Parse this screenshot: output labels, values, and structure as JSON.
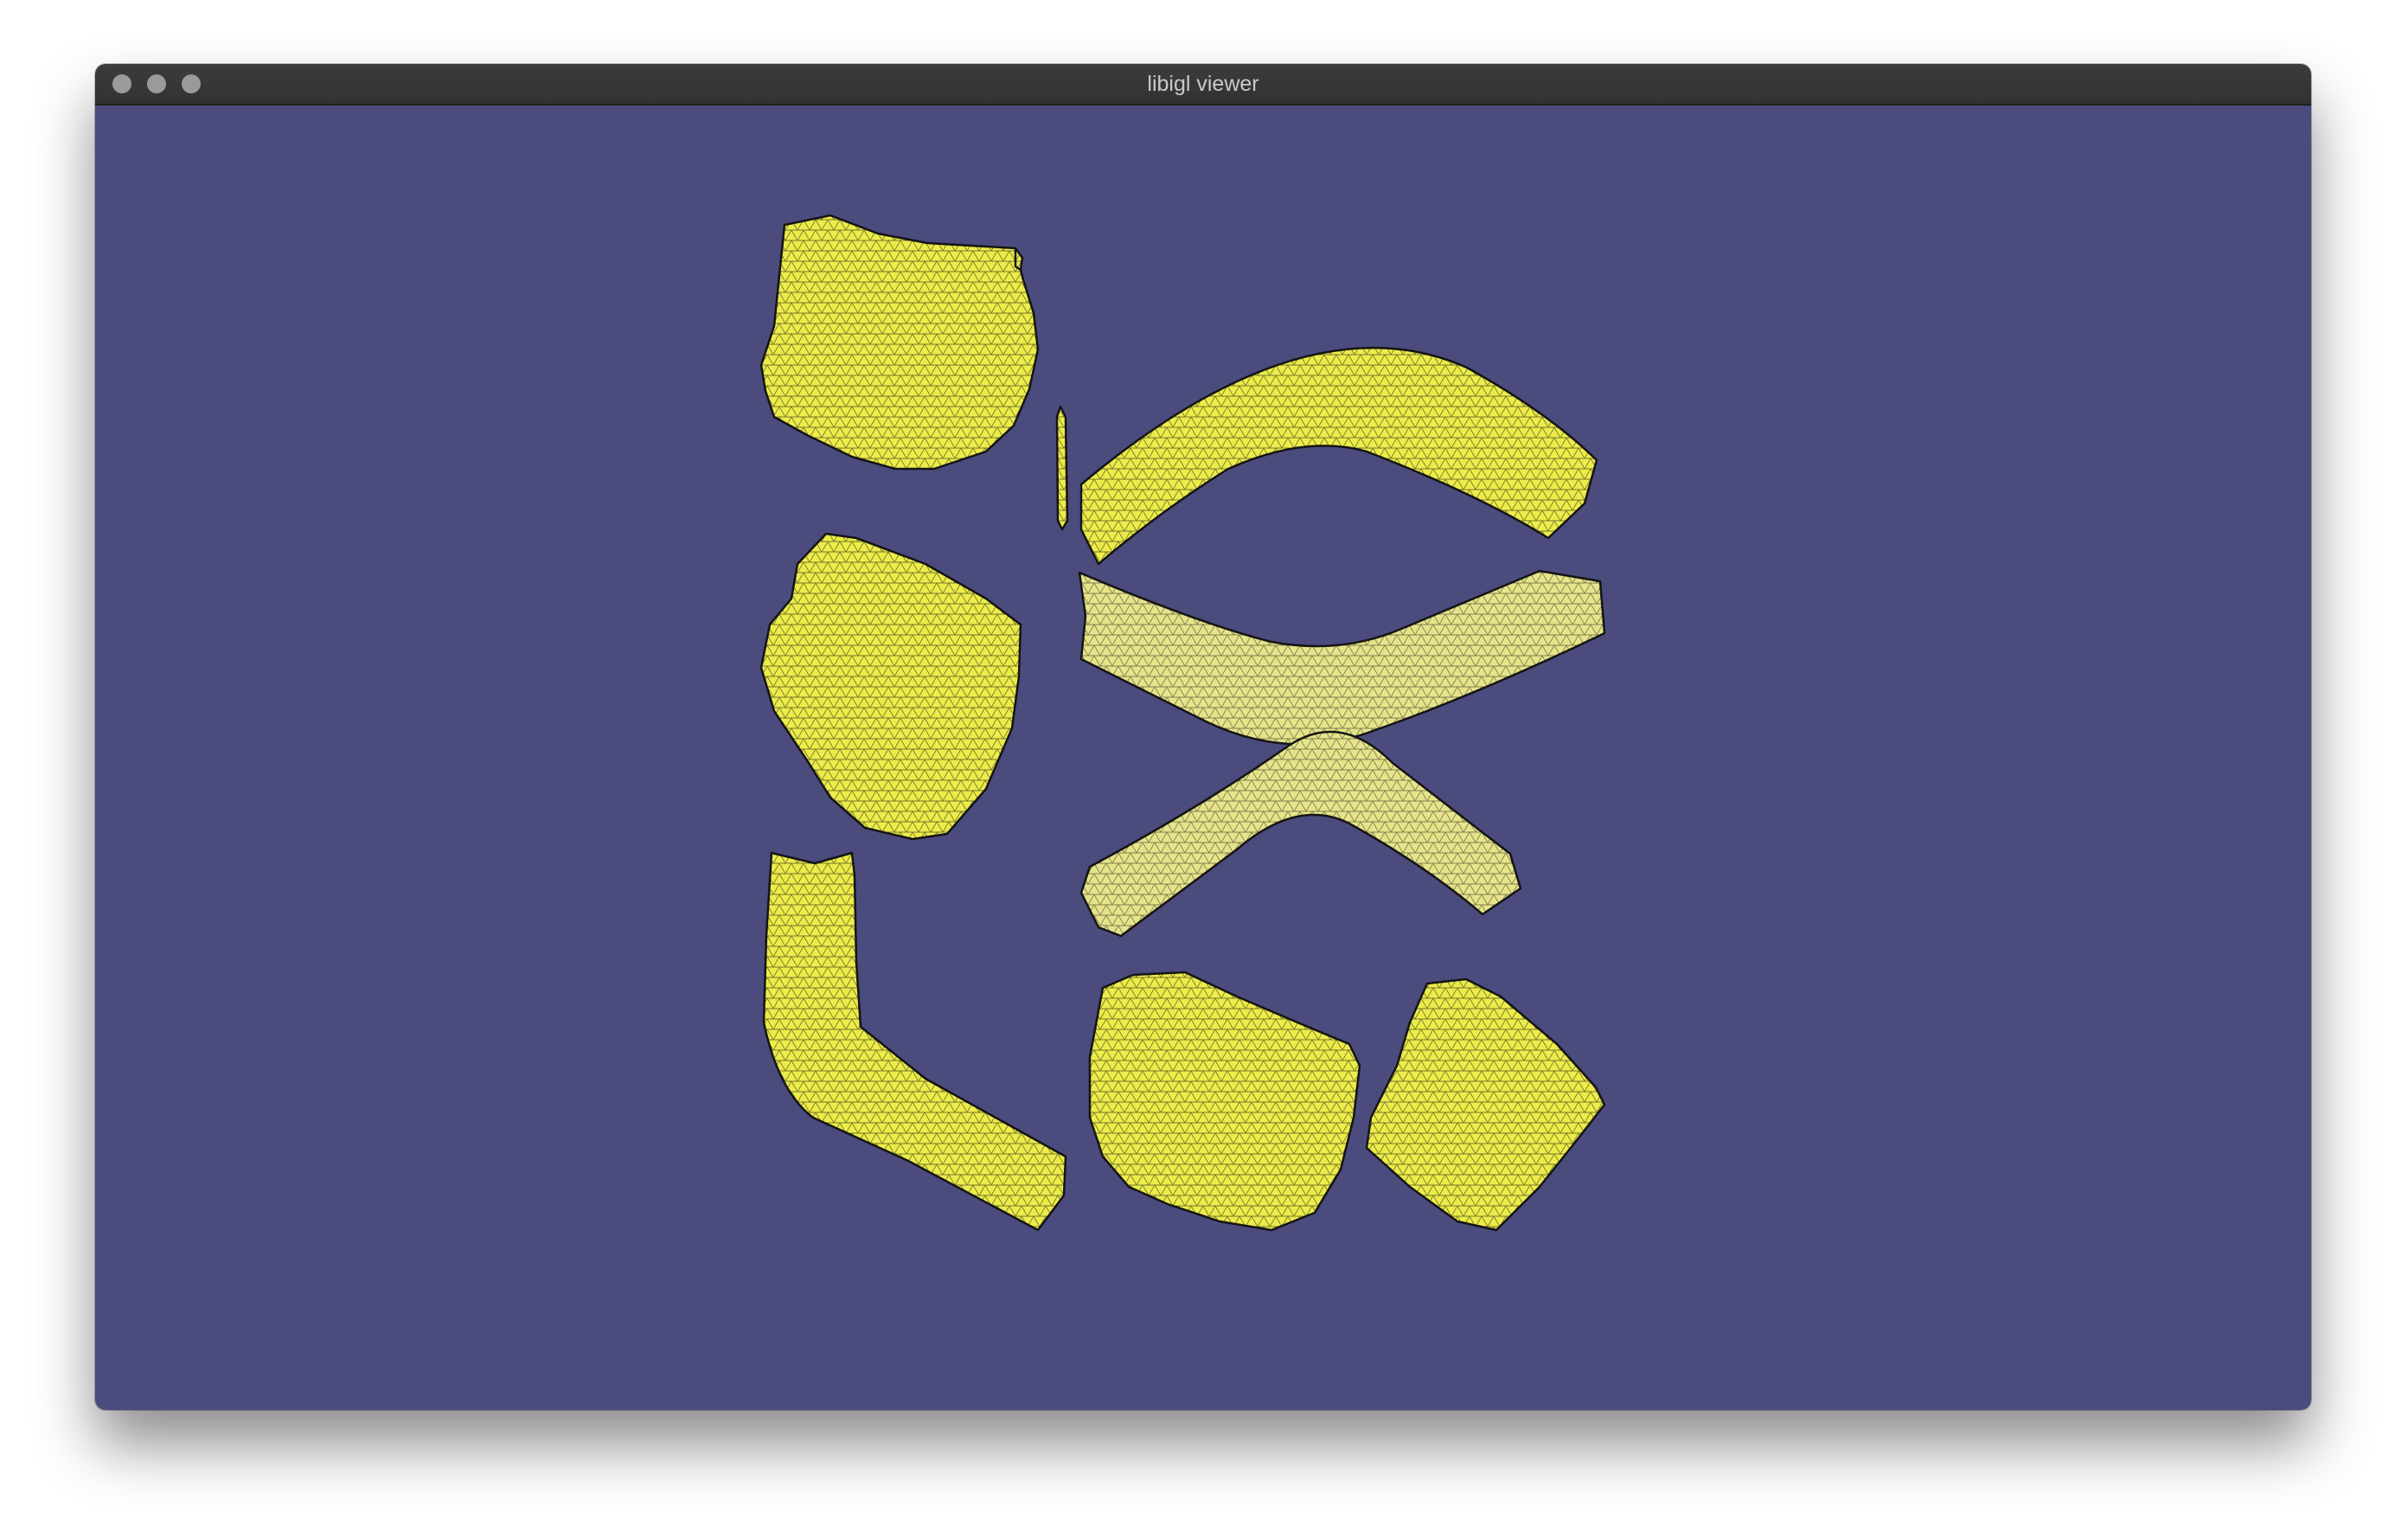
{
  "window": {
    "title": "libigl viewer",
    "controls": {
      "close": "traffic-light-close",
      "minimize": "traffic-light-minimize",
      "zoom": "traffic-light-zoom"
    }
  },
  "viewport": {
    "background_color": "#4b4b7d",
    "mesh_color": "#ecec4a",
    "wire_color": "#151515",
    "patch_count": 10
  }
}
